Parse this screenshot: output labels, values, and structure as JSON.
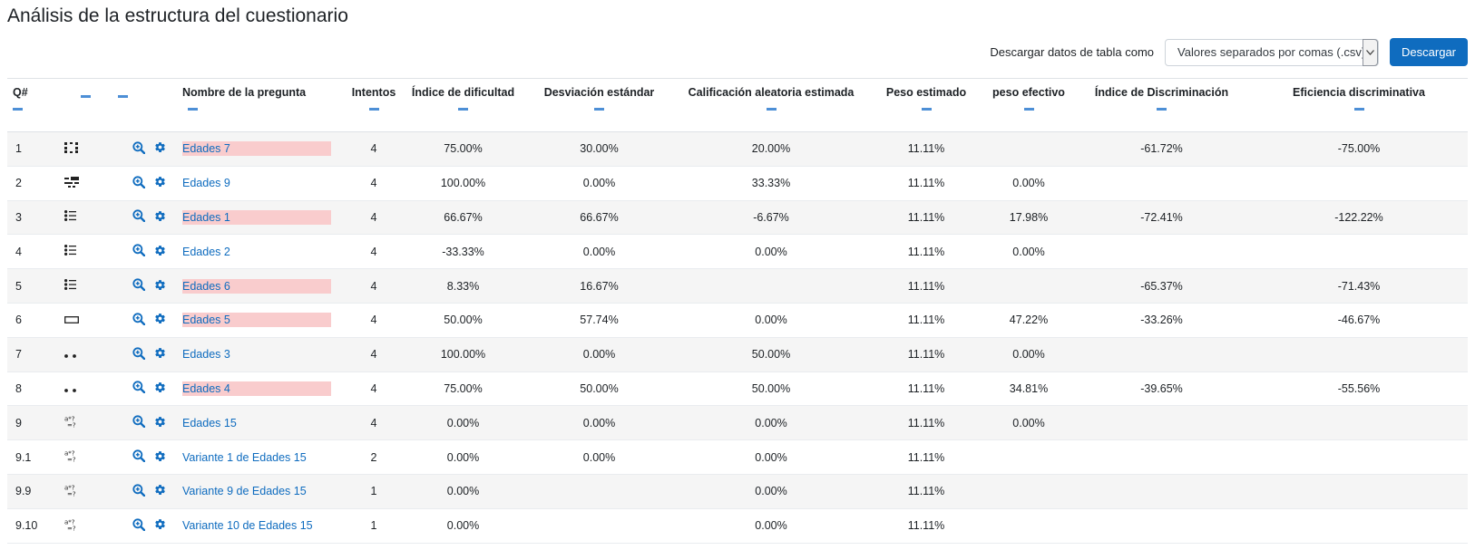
{
  "page": {
    "title": "Análisis de la estructura del cuestionario"
  },
  "download": {
    "label": "Descargar datos de tabla como",
    "selected_option": "Valores separados por comas (.csv)",
    "button_label": "Descargar"
  },
  "colors": {
    "accent": "#0f6cbf",
    "flag_background": "#f9cccd",
    "sort_marker": "#4d8fd6"
  },
  "table": {
    "headers": {
      "q": "Q#",
      "name": "Nombre de la pregunta",
      "attempts": "Intentos",
      "difficulty": "Índice de dificultad",
      "std_dev": "Desviación estándar",
      "random_guess": "Calificación aleatoria estimada",
      "intended_weight": "Peso estimado",
      "effective_weight": "peso efectivo",
      "discrimination_index": "Índice de Discriminación",
      "discrimination_efficiency": "Eficiencia discriminativa"
    },
    "rows": [
      {
        "q": "1",
        "type_icon": "matching-icon",
        "name": "Edades 7",
        "flagged": true,
        "attempts": "4",
        "difficulty": "75.00%",
        "std_dev": "30.00%",
        "random_guess": "20.00%",
        "intended_weight": "11.11%",
        "effective_weight": "",
        "discrimination_index": "-61.72%",
        "discrimination_efficiency": "-75.00%"
      },
      {
        "q": "2",
        "type_icon": "drag-drop-text-icon",
        "name": "Edades 9",
        "flagged": false,
        "attempts": "4",
        "difficulty": "100.00%",
        "std_dev": "0.00%",
        "random_guess": "33.33%",
        "intended_weight": "11.11%",
        "effective_weight": "0.00%",
        "discrimination_index": "",
        "discrimination_efficiency": ""
      },
      {
        "q": "3",
        "type_icon": "multichoice-icon",
        "name": "Edades 1",
        "flagged": true,
        "attempts": "4",
        "difficulty": "66.67%",
        "std_dev": "66.67%",
        "random_guess": "-6.67%",
        "intended_weight": "11.11%",
        "effective_weight": "17.98%",
        "discrimination_index": "-72.41%",
        "discrimination_efficiency": "-122.22%"
      },
      {
        "q": "4",
        "type_icon": "multichoice-icon",
        "name": "Edades 2",
        "flagged": false,
        "attempts": "4",
        "difficulty": "-33.33%",
        "std_dev": "0.00%",
        "random_guess": "0.00%",
        "intended_weight": "11.11%",
        "effective_weight": "0.00%",
        "discrimination_index": "",
        "discrimination_efficiency": ""
      },
      {
        "q": "5",
        "type_icon": "multichoice-icon",
        "name": "Edades 6",
        "flagged": true,
        "attempts": "4",
        "difficulty": "8.33%",
        "std_dev": "16.67%",
        "random_guess": "",
        "intended_weight": "11.11%",
        "effective_weight": "",
        "discrimination_index": "-65.37%",
        "discrimination_efficiency": "-71.43%"
      },
      {
        "q": "6",
        "type_icon": "short-answer-icon",
        "name": "Edades 5",
        "flagged": true,
        "attempts": "4",
        "difficulty": "50.00%",
        "std_dev": "57.74%",
        "random_guess": "0.00%",
        "intended_weight": "11.11%",
        "effective_weight": "47.22%",
        "discrimination_index": "-33.26%",
        "discrimination_efficiency": "-46.67%"
      },
      {
        "q": "7",
        "type_icon": "true-false-icon",
        "name": "Edades 3",
        "flagged": false,
        "attempts": "4",
        "difficulty": "100.00%",
        "std_dev": "0.00%",
        "random_guess": "50.00%",
        "intended_weight": "11.11%",
        "effective_weight": "0.00%",
        "discrimination_index": "",
        "discrimination_efficiency": ""
      },
      {
        "q": "8",
        "type_icon": "true-false-icon",
        "name": "Edades 4",
        "flagged": true,
        "attempts": "4",
        "difficulty": "75.00%",
        "std_dev": "50.00%",
        "random_guess": "50.00%",
        "intended_weight": "11.11%",
        "effective_weight": "34.81%",
        "discrimination_index": "-39.65%",
        "discrimination_efficiency": "-55.56%"
      },
      {
        "q": "9",
        "type_icon": "calculated-icon",
        "name": "Edades 15",
        "flagged": false,
        "attempts": "4",
        "difficulty": "0.00%",
        "std_dev": "0.00%",
        "random_guess": "0.00%",
        "intended_weight": "11.11%",
        "effective_weight": "0.00%",
        "discrimination_index": "",
        "discrimination_efficiency": ""
      },
      {
        "q": "9.1",
        "type_icon": "calculated-icon",
        "name": "Variante 1 de Edades 15",
        "flagged": false,
        "attempts": "2",
        "difficulty": "0.00%",
        "std_dev": "0.00%",
        "random_guess": "0.00%",
        "intended_weight": "11.11%",
        "effective_weight": "",
        "discrimination_index": "",
        "discrimination_efficiency": ""
      },
      {
        "q": "9.9",
        "type_icon": "calculated-icon",
        "name": "Variante 9 de Edades 15",
        "flagged": false,
        "attempts": "1",
        "difficulty": "0.00%",
        "std_dev": "",
        "random_guess": "0.00%",
        "intended_weight": "11.11%",
        "effective_weight": "",
        "discrimination_index": "",
        "discrimination_efficiency": ""
      },
      {
        "q": "9.10",
        "type_icon": "calculated-icon",
        "name": "Variante 10 de Edades 15",
        "flagged": false,
        "attempts": "1",
        "difficulty": "0.00%",
        "std_dev": "",
        "random_guess": "0.00%",
        "intended_weight": "11.11%",
        "effective_weight": "",
        "discrimination_index": "",
        "discrimination_efficiency": ""
      }
    ]
  }
}
